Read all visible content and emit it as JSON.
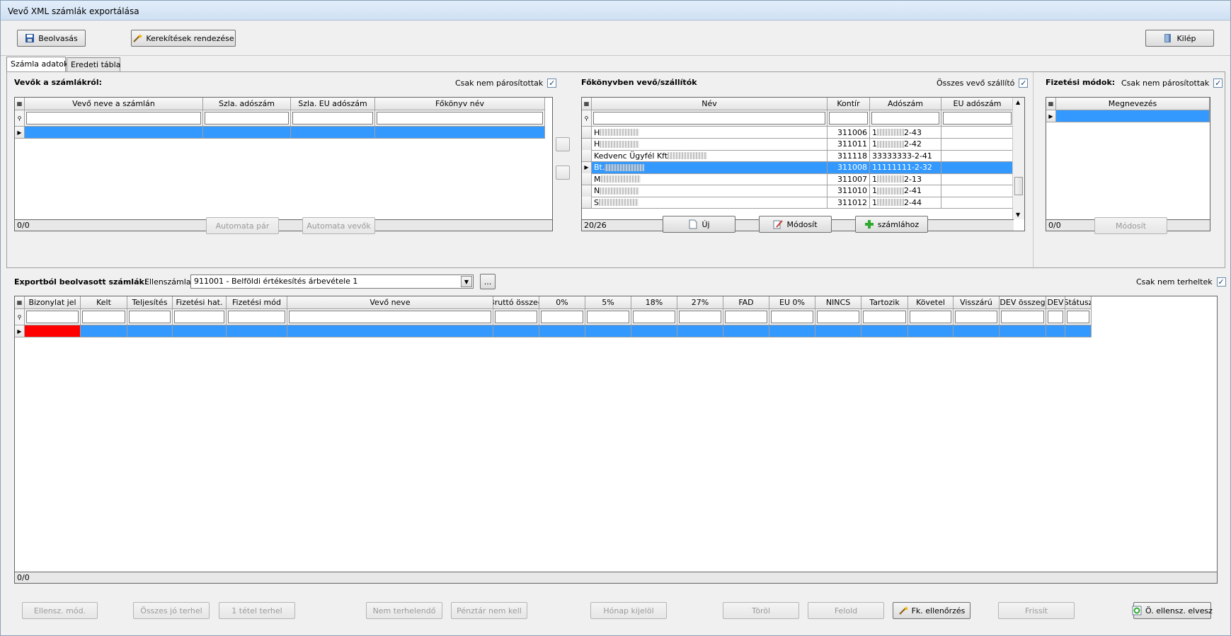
{
  "window": {
    "title": "Vevő XML számlák exportálása"
  },
  "toolbar": {
    "read_label": "Beolvasás",
    "rounding_label": "Kerekítések rendezése",
    "exit_label": "Kilép"
  },
  "tabs": [
    {
      "label": "Számla adatok"
    },
    {
      "label": "Eredeti tábla"
    }
  ],
  "customers": {
    "title": "Vevők a számlákról:",
    "only_unpaired_label": "Csak nem párosítottak",
    "only_unpaired_checked": true,
    "columns": [
      "Vevő neve a számlán",
      "Szla. adószám",
      "Szla. EU adószám",
      "Főkönyv név"
    ],
    "footer": "0/0",
    "auto_pair_label": "Automata pár",
    "auto_customers_label": "Automata vevők"
  },
  "ledger": {
    "title": "Főkönyvben vevő/szállítók",
    "all_label": "Összes vevő szállító",
    "all_checked": true,
    "columns": [
      "Név",
      "Kontír",
      "Adószám",
      "EU adószám"
    ],
    "rows": [
      {
        "name": "H",
        "kontir": "311006",
        "tax": "1",
        "tax_end": "2-43",
        "eu": "",
        "selected": false
      },
      {
        "name": "H",
        "kontir": "311011",
        "tax": "1",
        "tax_end": "2-42",
        "eu": "",
        "selected": false
      },
      {
        "name": "Kedvenc Ügyfél Kft",
        "kontir": "311118",
        "tax": "33333333-2-41",
        "tax_end": "",
        "eu": "",
        "selected": false
      },
      {
        "name": "Bt.",
        "kontir": "311008",
        "tax": "11111111-2-32",
        "tax_end": "",
        "eu": "",
        "selected": true
      },
      {
        "name": "M",
        "kontir": "311007",
        "tax": "1",
        "tax_end": "2-13",
        "eu": "",
        "selected": false
      },
      {
        "name": "N",
        "kontir": "311010",
        "tax": "1",
        "tax_end": "2-41",
        "eu": "",
        "selected": false
      },
      {
        "name": "S",
        "kontir": "311012",
        "tax": "1",
        "tax_end": "2-44",
        "eu": "",
        "selected": false
      }
    ],
    "footer": "20/26",
    "new_label": "Új",
    "modify_label": "Módosít",
    "to_invoice_label": "számlához"
  },
  "payment": {
    "title": "Fizetési módok:",
    "only_unpaired_label": "Csak nem párosítottak",
    "only_unpaired_checked": true,
    "columns": [
      "Megnevezés"
    ],
    "footer": "0/0",
    "modify_label": "Módosít"
  },
  "invoices": {
    "title": "Exportból beolvasott számlák:",
    "contra_label": "Ellenszámla:",
    "contra_value": "911001 - Belföldi értékesítés árbevétele 1",
    "ellipsis_label": "...",
    "only_uncharged_label": "Csak nem terheltek",
    "only_uncharged_checked": true,
    "columns": [
      "Bizonylat jel",
      "Kelt",
      "Teljesítés",
      "Fizetési hat.",
      "Fizetési mód",
      "Vevő neve",
      "Bruttó összeg",
      "0%",
      "5%",
      "18%",
      "27%",
      "FAD",
      "EU 0%",
      "NINCS",
      "Tartozik",
      "Követel",
      "Visszárú",
      "DEV összeg",
      "DEV",
      "Státusz"
    ],
    "footer": "0/0"
  },
  "bottom_buttons": {
    "contra_mod": "Ellensz. mód.",
    "all_good_charge": "Összes jó terhel",
    "one_item_charge": "1 tétel terhel",
    "not_chargeable": "Nem terhelendő",
    "no_cash": "Pénztár nem kell",
    "month_select": "Hónap kijelöl",
    "delete": "Töröl",
    "release": "Felold",
    "fk_check": "Fk. ellenőrzés",
    "refresh": "Frissít",
    "contra_loss": "Ö. ellensz. elvesz"
  }
}
